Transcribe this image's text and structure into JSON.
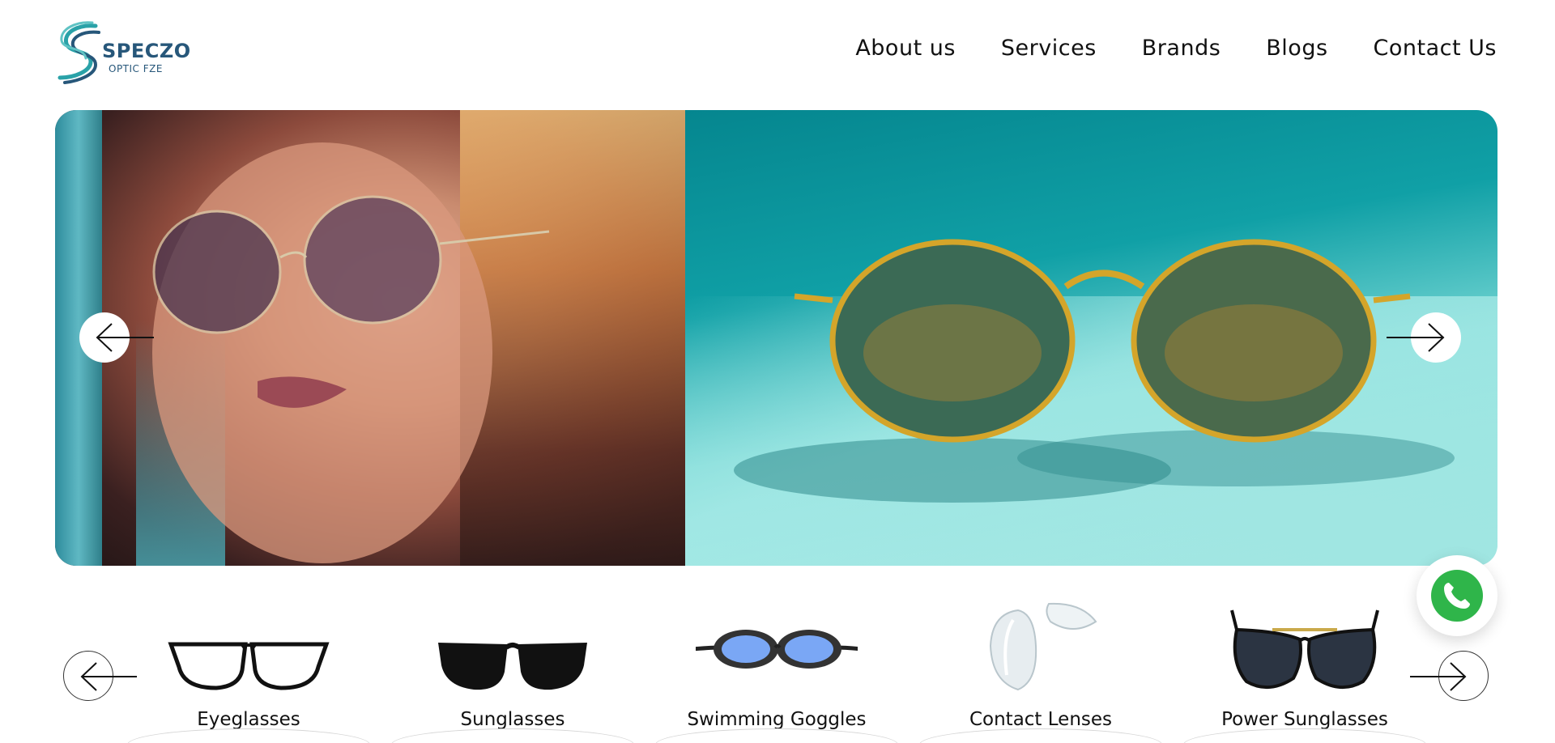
{
  "brand": {
    "name": "SPECZO",
    "subtitle": "OPTIC FZE",
    "logo_icon": "speczo-logo-icon"
  },
  "nav": {
    "items": [
      {
        "label": "About us"
      },
      {
        "label": "Services"
      },
      {
        "label": "Brands"
      },
      {
        "label": "Blogs"
      },
      {
        "label": "Contact Us"
      }
    ]
  },
  "hero": {
    "left_image": "woman-wearing-sunglasses-photo",
    "right_image": "gold-round-sunglasses-on-teal-photo",
    "prev_icon": "arrow-left-icon",
    "next_icon": "arrow-right-icon"
  },
  "categories": {
    "items": [
      {
        "label": "Eyeglasses",
        "icon": "eyeglasses-icon"
      },
      {
        "label": "Sunglasses",
        "icon": "sunglasses-icon"
      },
      {
        "label": "Swimming Goggles",
        "icon": "swimming-goggles-icon"
      },
      {
        "label": "Contact Lenses",
        "icon": "contact-lenses-icon"
      },
      {
        "label": "Power Sunglasses",
        "icon": "power-sunglasses-icon"
      }
    ],
    "prev_icon": "arrow-left-icon",
    "next_icon": "arrow-right-icon"
  },
  "whatsapp": {
    "icon": "whatsapp-icon"
  },
  "colors": {
    "brand_blue": "#27577a",
    "brand_teal": "#2aa2a8",
    "whatsapp_green": "#2fb54a",
    "hero_teal": "#10a0a6"
  }
}
